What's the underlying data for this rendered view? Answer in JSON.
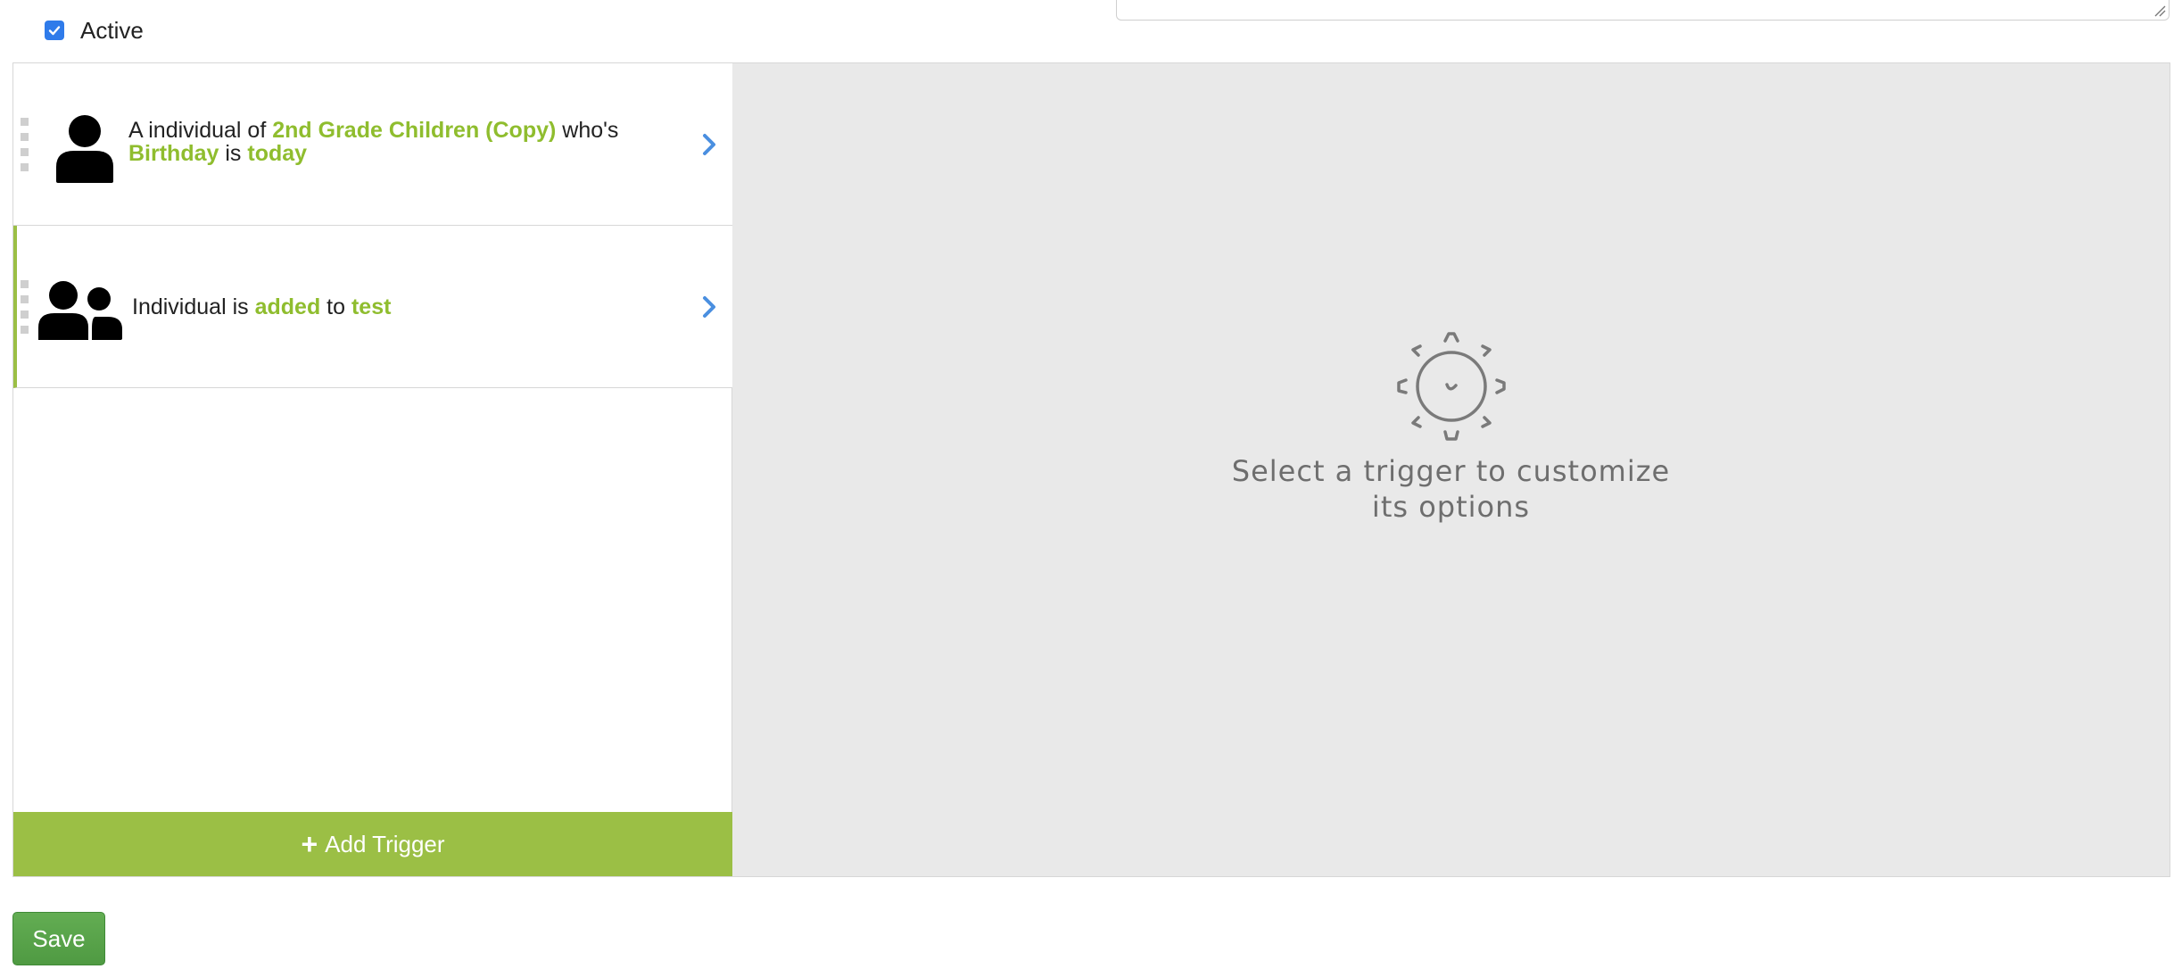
{
  "header": {
    "active_label": "Active",
    "active_checked": true
  },
  "triggers": [
    {
      "icon": "person-icon",
      "prefix": "A individual of",
      "group": "2nd Grade Children (Copy)",
      "middle": "who's",
      "field": "Birthday",
      "verb": "is",
      "value": "today"
    },
    {
      "icon": "people-icon",
      "prefix": "Individual is",
      "action": "added",
      "middle": "to",
      "target": "test",
      "selected": true
    }
  ],
  "add_trigger_label": "Add Trigger",
  "empty_state": {
    "line1": "Select a trigger to customize",
    "line2": "its options"
  },
  "save_label": "Save",
  "colors": {
    "accent_green": "#9bbf45",
    "highlight_text": "#8fbd2e",
    "save_green": "#5aa44b",
    "chevron_blue": "#4a8fe0",
    "panel_gray": "#e9e9e9"
  }
}
